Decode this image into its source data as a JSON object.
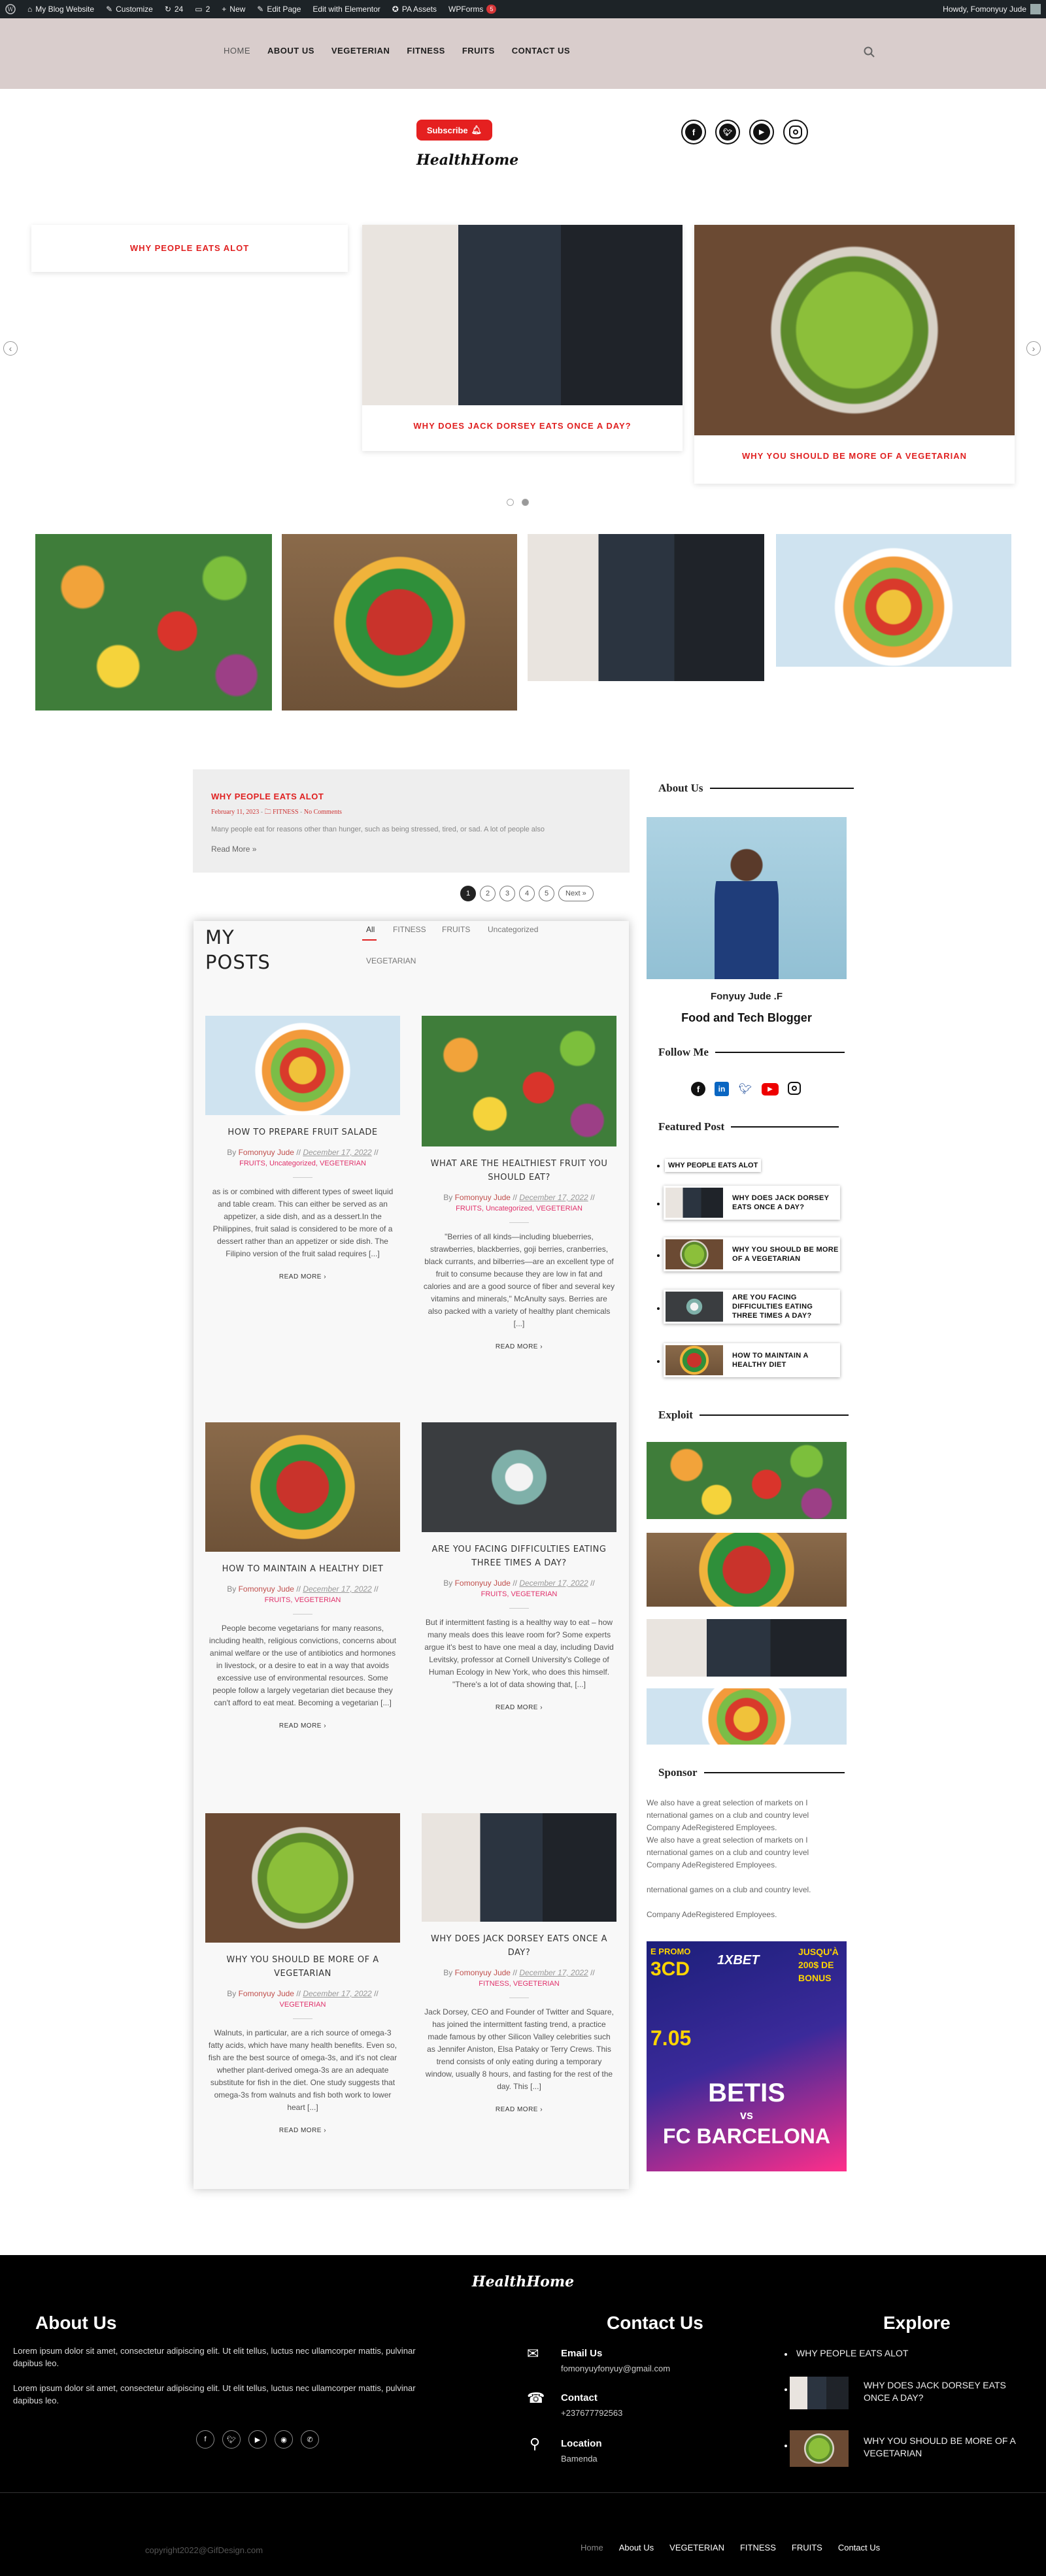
{
  "admin_bar": {
    "site_name": "My Blog Website",
    "customize": "Customize",
    "updates": "24",
    "comments": "2",
    "new": "New",
    "edit_page": "Edit Page",
    "edit_elementor": "Edit with Elementor",
    "pa_assets": "PA Assets",
    "wpforms": "WPForms",
    "wpforms_badge": "5",
    "howdy": "Howdy, Fomonyuy Jude"
  },
  "nav": {
    "items": [
      "HOME",
      "ABOUT US",
      "VEGETERIAN",
      "FITNESS",
      "FRUITS",
      "CONTACT US"
    ],
    "active_index": 0,
    "search_icon": "search-icon"
  },
  "header": {
    "subscribe_label": "Subscribe",
    "logo_text": "HealthHome",
    "social_icons": [
      "facebook-icon",
      "twitter-icon",
      "youtube-icon",
      "instagram-icon"
    ]
  },
  "slider": {
    "slides": [
      {
        "title": "WHY PEOPLE EATS ALOT"
      },
      {
        "title": "WHY DOES JACK DORSEY EATS ONCE A DAY?"
      },
      {
        "title": "WHY YOU SHOULD BE MORE OF A VEGETARIAN"
      }
    ],
    "prev_label": "‹",
    "next_label": "›"
  },
  "gallery": [
    "fruits",
    "heart-vegetables",
    "jack-dorsey",
    "fruit-bowl"
  ],
  "featured_post": {
    "title": "WHY PEOPLE EATS ALOT",
    "date": "February 11, 2023",
    "category": "FITNESS",
    "comments": "No Comments",
    "excerpt": "Many people eat for reasons other than hunger, such as being stressed, tired, or sad. A lot of people also",
    "read_more": "Read More »"
  },
  "pagination": {
    "pages": [
      "1",
      "2",
      "3",
      "4",
      "5"
    ],
    "active": "1",
    "next": "Next »"
  },
  "posts_section": {
    "heading_line1": "MY",
    "heading_line2": "POSTS",
    "filters": [
      "All",
      "FITNESS",
      "FRUITS",
      "Uncategorized",
      "VEGETARIAN"
    ],
    "active_filter": "All",
    "by": "By",
    "read_more": "READ MORE  ›",
    "posts": [
      {
        "title": "HOW TO PREPARE FRUIT SALADE",
        "author": "Fomonyuy Jude",
        "date": "December 17, 2022",
        "categories": "FRUITS, Uncategorized, VEGETERIAN",
        "excerpt": "as is or combined with different types of sweet liquid and table cream. This can either be served as an appetizer, a side dish, and as a dessert.In the Philippines, fruit salad is considered to be more of a dessert rather than an appetizer or side dish. The Filipino version of the fruit salad requires [...]"
      },
      {
        "title": "WHAT ARE THE HEALTHIEST FRUIT YOU SHOULD EAT?",
        "author": "Fomonyuy Jude",
        "date": "December 17, 2022",
        "categories": "FRUITS, Uncategorized, VEGETERIAN",
        "excerpt": "\"Berries of all kinds—including blueberries, strawberries, blackberries, goji berries, cranberries, black currants, and bilberries—are an excellent type of fruit to consume because they are low in fat and calories and are a good source of fiber and several key vitamins and minerals,\" McAnulty says. Berries are also packed with a variety of healthy plant chemicals [...]"
      },
      {
        "title": "HOW TO MAINTAIN A HEALTHY DIET",
        "author": "Fomonyuy Jude",
        "date": "December 17, 2022",
        "categories": "FRUITS, VEGETERIAN",
        "excerpt": "People become vegetarians for many reasons, including health, religious convictions, concerns about animal welfare or the use of antibiotics and hormones in livestock, or a desire to eat in a way that avoids excessive use of environmental resources. Some people follow a largely vegetarian diet because they can't afford to eat meat. Becoming a vegetarian [...]"
      },
      {
        "title": "ARE YOU FACING DIFFICULTIES EATING THREE TIMES A DAY?",
        "author": "Fomonyuy Jude",
        "date": "December 17, 2022",
        "categories": "FRUITS, VEGETERIAN",
        "excerpt": "But if intermittent fasting is a healthy way to eat – how many meals does this leave room for? Some experts argue it's best to have one meal a day, including David Levitsky, professor at Cornell University's College of Human Ecology in New York, who does this himself. \"There's a lot of data showing that, [...]"
      },
      {
        "title": "WHY YOU SHOULD BE MORE OF A VEGETARIAN",
        "author": "Fomonyuy Jude",
        "date": "December 17, 2022",
        "categories": "VEGETERIAN",
        "excerpt": "Walnuts, in particular, are a rich source of omega-3 fatty acids, which have many health benefits. Even so, fish are the best source of omega-3s, and it's not clear whether plant-derived omega-3s are an adequate substitute for fish in the diet. One study suggests that omega-3s from walnuts and fish both work to lower heart [...]"
      },
      {
        "title": "WHY DOES JACK DORSEY EATS ONCE A DAY?",
        "author": "Fomonyuy Jude",
        "date": "December 17, 2022",
        "categories": "FITNESS, VEGETERIAN",
        "excerpt": "Jack Dorsey, CEO and Founder of Twitter and Square, has joined the intermittent fasting trend, a practice made famous by other Silicon Valley celebrities such as Jennifer Aniston, Elsa Pataky or Terry Crews. This trend consists of only eating during a temporary window, usually 8 hours, and fasting for the rest of the day. This [...]"
      }
    ]
  },
  "sidebar": {
    "about_heading": "About Us",
    "about_name": "Fonyuy Jude .F",
    "about_role": "Food and Tech Blogger",
    "follow_heading": "Follow Me",
    "follow_icons": [
      "facebook-icon",
      "linkedin-icon",
      "twitter-icon",
      "youtube-icon",
      "instagram-icon"
    ],
    "featured_heading": "Featured Post",
    "featured_first": "WHY PEOPLE EATS ALOT",
    "featured_items": [
      "WHY DOES JACK DORSEY EATS ONCE A DAY?",
      "WHY YOU SHOULD BE MORE OF A VEGETARIAN",
      "ARE YOU FACING DIFFICULTIES EATING THREE TIMES A DAY?",
      "HOW TO MAINTAIN A HEALTHY DIET"
    ],
    "exploit_heading": "Exploit",
    "sponsor_heading": "Sponsor",
    "sponsor_lines": [
      "We also have a great selection of markets on I",
      "nternational games on a club and country level",
      "Company AdeRegistered Employees.",
      " We also have a great selection of markets on I",
      "nternational games on a club and country level",
      "Company AdeRegistered Employees.",
      "",
      "nternational games on a club and country level.",
      "",
      "Company AdeRegistered Employees."
    ],
    "ad": {
      "promo_left": "E PROMO",
      "code": "3CD",
      "brand": "1XBET",
      "promo_right_1": "JUSQU'À",
      "promo_right_2": "200$ DE",
      "promo_right_3": "BONUS",
      "date": "7.05",
      "team1": "BETIS",
      "vs": "vs",
      "team2": "FC BARCELONA"
    }
  },
  "footer": {
    "logo": "HealthHome",
    "about_heading": "About Us",
    "about_text_1": "Lorem ipsum dolor sit amet, consectetur adipiscing elit. Ut elit tellus, luctus nec ullamcorper mattis, pulvinar dapibus leo.",
    "about_text_2": "Lorem ipsum dolor sit amet, consectetur adipiscing elit. Ut elit tellus, luctus nec ullamcorper mattis, pulvinar dapibus leo.",
    "social_icons": [
      "facebook-icon",
      "twitter-icon",
      "youtube-icon",
      "github-icon",
      "whatsapp-icon"
    ],
    "contact_heading": "Contact Us",
    "email_label": "Email Us",
    "email_value": "fomonyuyfonyuy@gmail.com",
    "phone_label": "Contact",
    "phone_value": "+237677792563",
    "location_label": "Location",
    "location_value": "Bamenda",
    "explore_heading": "Explore",
    "explore_items": [
      "WHY PEOPLE EATS ALOT",
      "WHY DOES JACK DORSEY EATS ONCE A DAY?",
      "WHY YOU SHOULD BE MORE OF A VEGETARIAN"
    ],
    "copyright": "copyright2022@GifDesign.com",
    "nav": [
      "Home",
      "About Us",
      "VEGETERIAN",
      "FITNESS",
      "FRUITS",
      "Contact Us"
    ]
  }
}
